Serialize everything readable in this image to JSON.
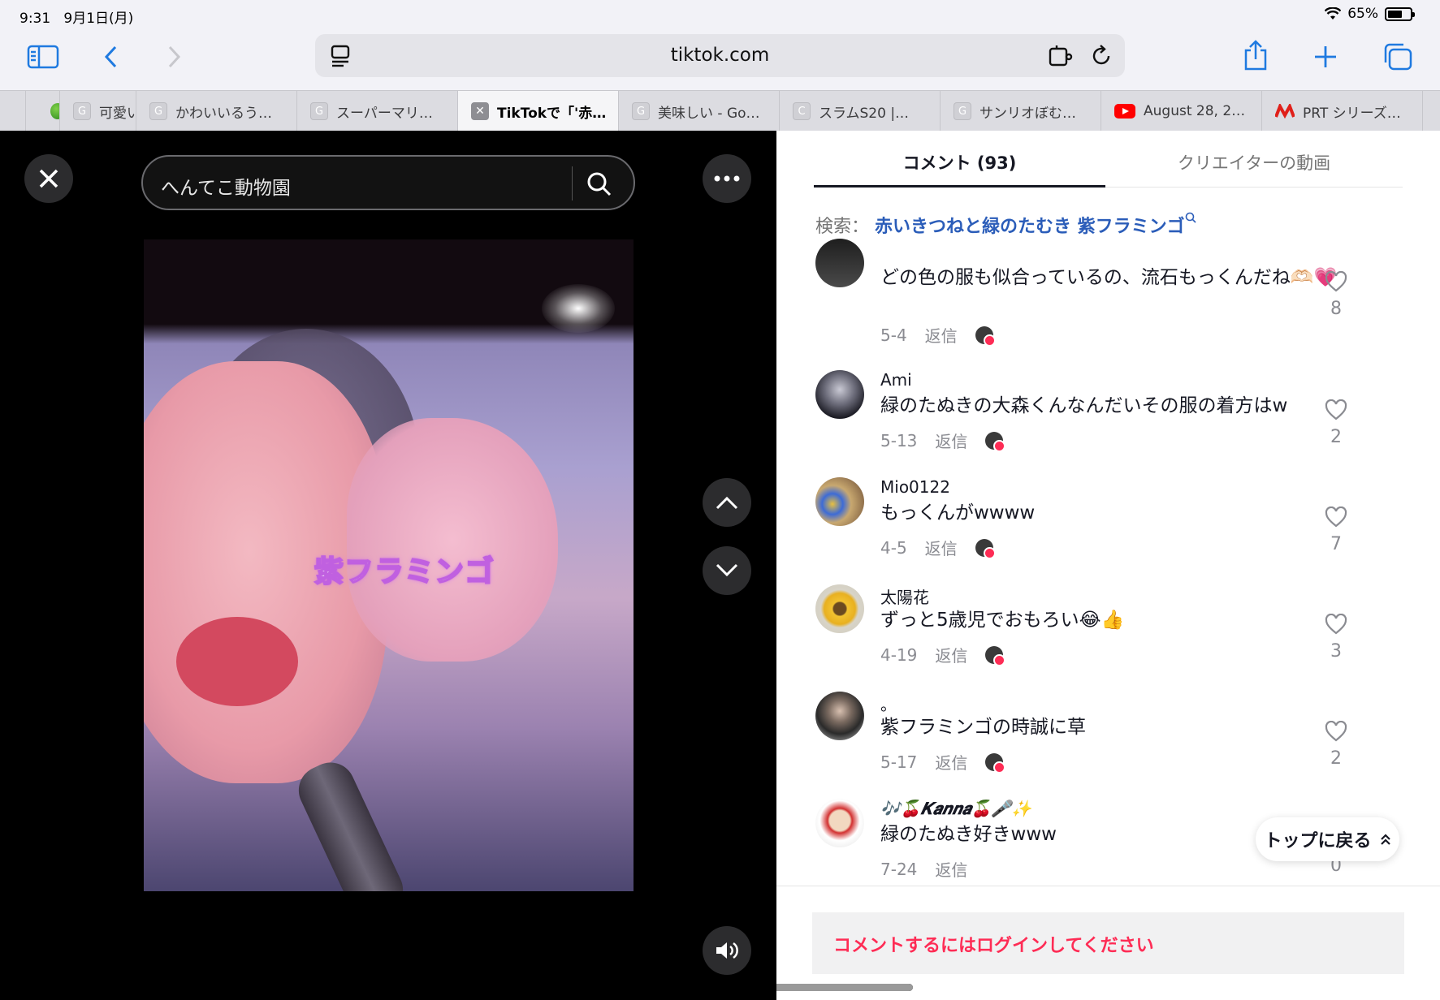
{
  "status_bar": {
    "time": "9:31",
    "date": "9月1日(月)",
    "battery": "65%",
    "battery_level": 0.65
  },
  "browser": {
    "url": "tiktok.com",
    "tabs": [
      {
        "label": "",
        "favicon": "green-apple-icon"
      },
      {
        "label": "可愛い",
        "favicon": "G"
      },
      {
        "label": "かわいいるう…",
        "favicon": "G"
      },
      {
        "label": "スーパーマリ…",
        "favicon": "G"
      },
      {
        "label": "TikTokで「'赤…",
        "favicon": "close-icon",
        "active": true
      },
      {
        "label": "美味しい - Go…",
        "favicon": "G"
      },
      {
        "label": "スラムS20 |…",
        "favicon": "C"
      },
      {
        "label": "サンリオぼむ…",
        "favicon": "G"
      },
      {
        "label": "August 28, 2…",
        "favicon": "youtube-icon"
      },
      {
        "label": "PRT シリーズ…",
        "favicon": "prt-logo-icon"
      }
    ]
  },
  "video": {
    "search_value": "へんてこ動物園",
    "caption": "紫フラミンゴ"
  },
  "comments_panel": {
    "tab_comments": "コメント (93)",
    "tab_creator": "クリエイターの動画",
    "search_label": "検索：",
    "search_query": "赤いきつねと緑のたむき 紫フラミンゴ",
    "reply_label": "返信",
    "comments": [
      {
        "user": "",
        "text": "どの色の服も似合っているの、流石もっくんだね🫶🏻💗",
        "date": "5-4",
        "likes": "8"
      },
      {
        "user": "Ami",
        "text": "緑のたぬきの大森くんなんだいその服の着方はw",
        "date": "5-13",
        "likes": "2"
      },
      {
        "user": "Mio0122",
        "text": "もっくんがwwww",
        "date": "4-5",
        "likes": "7"
      },
      {
        "user": "太陽花",
        "text": "ずっと5歳児でおもろい😂👍",
        "date": "4-19",
        "likes": "3"
      },
      {
        "user": "。",
        "text": "紫フラミンゴの時誠に草",
        "date": "5-17",
        "likes": "2"
      },
      {
        "user": "🎶🍒𝑲𝒂𝒏𝒏𝒂🍒🎤✨",
        "text": "緑のたぬき好きwww",
        "date": "7-24",
        "likes": "0"
      }
    ],
    "back_to_top": "トップに戻る",
    "login_prompt": "コメントするにはログインしてください"
  }
}
